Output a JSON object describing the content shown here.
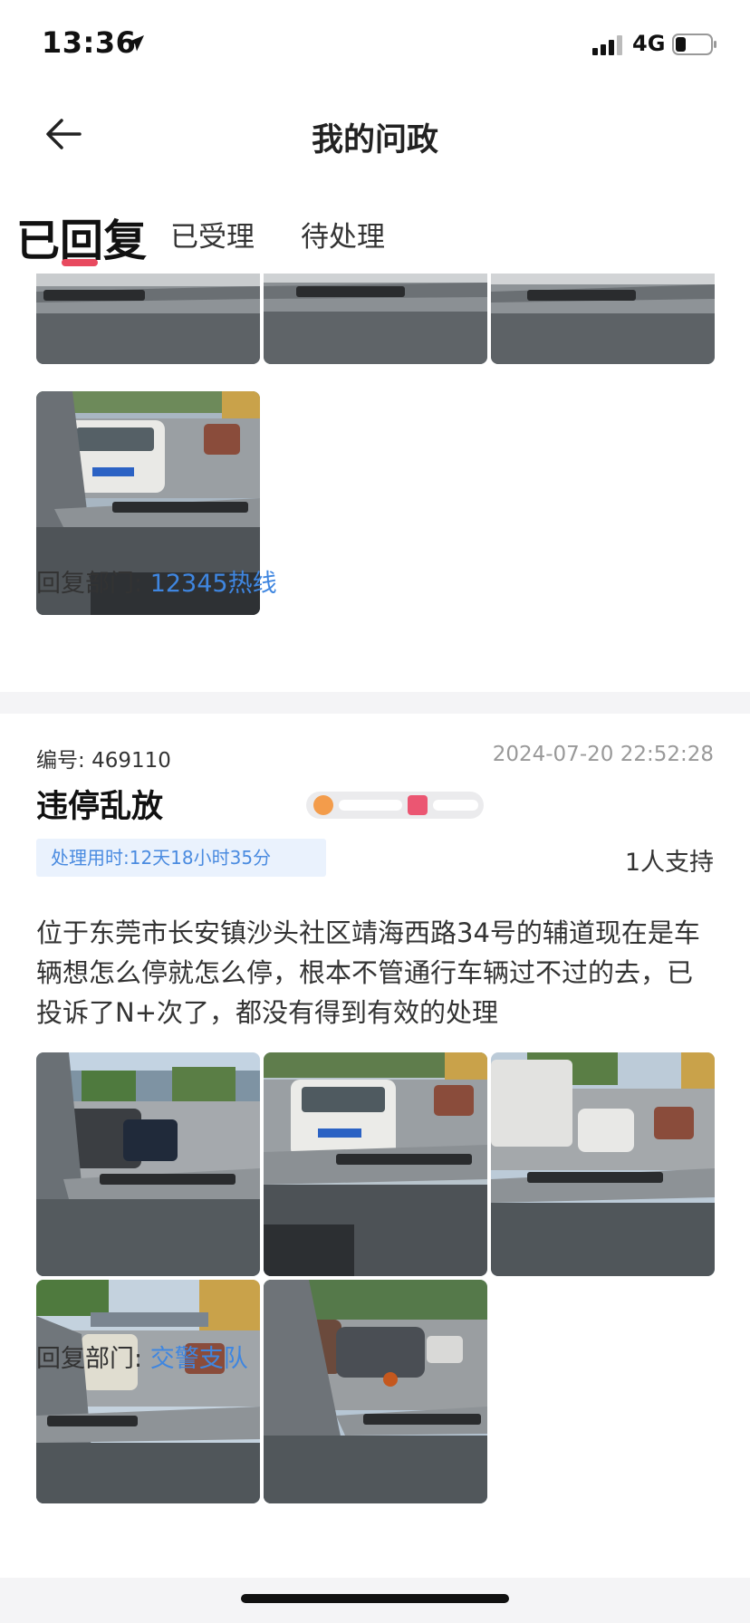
{
  "status_bar": {
    "time": "13:36",
    "network": "4G"
  },
  "nav": {
    "title": "我的问政"
  },
  "tabs": [
    {
      "label": "已回复"
    },
    {
      "label": "已受理"
    },
    {
      "label": "待处理"
    }
  ],
  "previous_card": {
    "reply_label": "回复部门:",
    "reply_dept": "12345热线",
    "photo_count": 4
  },
  "card": {
    "id_label": "编号:",
    "id_value": "469110",
    "datetime": "2024-07-20 22:52:28",
    "title": "违停乱放",
    "time_badge": "处理用时:12天18小时35分",
    "support": "1人支持",
    "description": "位于东莞市长安镇沙头社区靖海西路34号的辅道现在是车辆想怎么停就怎么停，根本不管通行车辆过不过的去，已投诉了N+次了，都没有得到有效的处理",
    "photo_count": 5,
    "reply_label": "回复部门:",
    "reply_dept": "交警支队"
  },
  "colors": {
    "accent": "#e84a5f",
    "link": "#3f86e0",
    "badge_bg": "#eaf2fd",
    "badge_text": "#4a8be0",
    "divider": "#f4f4f6"
  },
  "icons": [
    "location-arrow-icon",
    "signal-icon",
    "battery-icon",
    "back-arrow-icon"
  ]
}
